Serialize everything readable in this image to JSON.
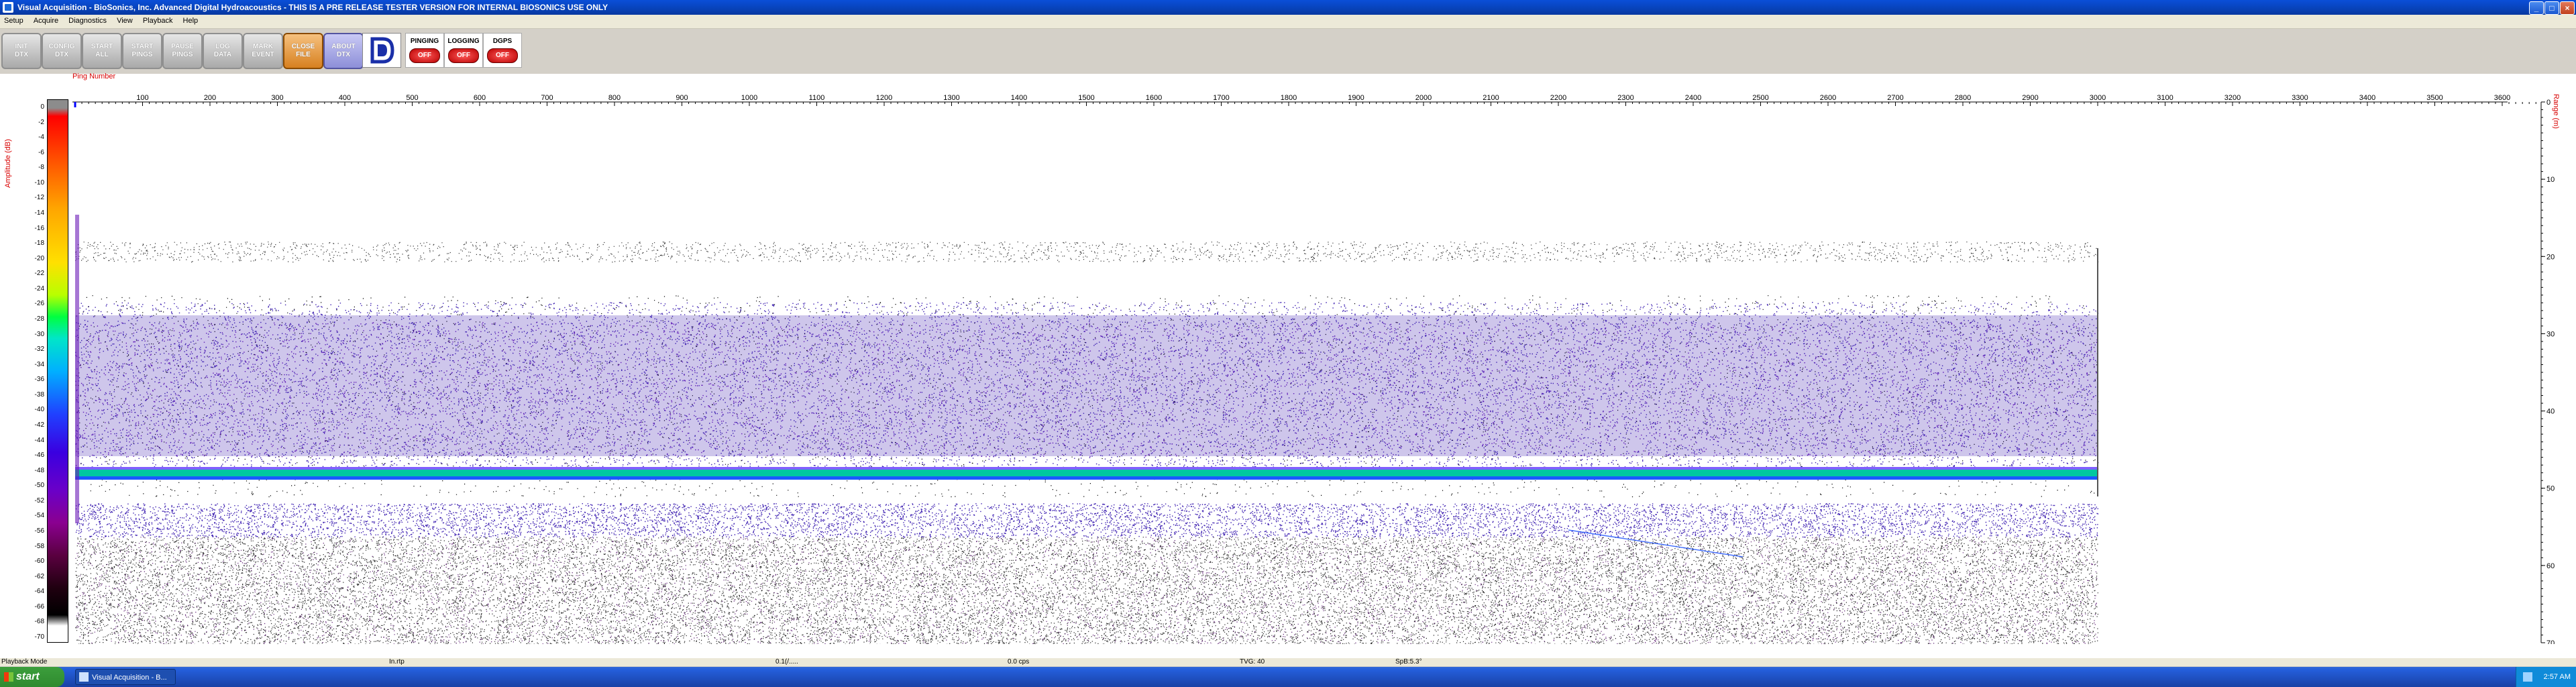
{
  "window": {
    "title": "Visual Acquisition  -  BioSonics, Inc.    Advanced Digital Hydroacoustics   -  THIS IS A PRE RELEASE TESTER VERSION FOR INTERNAL BIOSONICS USE ONLY",
    "min": "_",
    "max": "□",
    "close": "×"
  },
  "menu": [
    "Setup",
    "Acquire",
    "Diagnostics",
    "View",
    "Playback",
    "Help"
  ],
  "toolbar": {
    "buttons": [
      {
        "label": "INIT\nDTX",
        "style": "gray"
      },
      {
        "label": "CONFIG\nDTX",
        "style": "gray"
      },
      {
        "label": "START\nALL",
        "style": "gray"
      },
      {
        "label": "START\nPINGS",
        "style": "gray"
      },
      {
        "label": "PAUSE\nPINGS",
        "style": "gray"
      },
      {
        "label": "LOG\nDATA",
        "style": "gray"
      },
      {
        "label": "MARK\nEVENT",
        "style": "gray"
      },
      {
        "label": "CLOSE\nFILE",
        "style": "orange"
      },
      {
        "label": "ABOUT\nDTX",
        "style": "blue"
      }
    ],
    "indicators": [
      {
        "label": "PINGING",
        "state": "OFF"
      },
      {
        "label": "LOGGING",
        "state": "OFF"
      },
      {
        "label": "DGPS",
        "state": "OFF"
      }
    ]
  },
  "echogram": {
    "amplitude_axis_label": "Amplitude (dB)",
    "amplitude_ticks": [
      "0",
      "-2",
      "-4",
      "-6",
      "-8",
      "-10",
      "-12",
      "-14",
      "-16",
      "-18",
      "-20",
      "-22",
      "-24",
      "-26",
      "-28",
      "-30",
      "-32",
      "-34",
      "-36",
      "-38",
      "-40",
      "-42",
      "-44",
      "-46",
      "-48",
      "-50",
      "-52",
      "-54",
      "-56",
      "-58",
      "-60",
      "-62",
      "-64",
      "-66",
      "-68",
      "-70"
    ],
    "ping_axis_label": "Ping Number",
    "ping_ticks": [
      "100",
      "200",
      "300",
      "400",
      "500",
      "600",
      "700",
      "800",
      "900",
      "1000",
      "1100",
      "1200",
      "1300",
      "1400",
      "1500",
      "1600",
      "1700",
      "1800",
      "1900",
      "2000",
      "2100",
      "2200",
      "2300",
      "2400",
      "2500",
      "2600",
      "2700",
      "2800",
      "2900",
      "3000",
      "3100",
      "3200",
      "3300",
      "3400",
      "3500",
      "3600"
    ],
    "range_axis_label": "Range (m)",
    "range_ticks": [
      "0",
      "10",
      "20",
      "30",
      "40",
      "50",
      "60",
      "70.0"
    ],
    "ping_max": 3000,
    "colors": {
      "bottom": "#00c8a0",
      "band": "#3a1cb0",
      "noise": "#000000"
    }
  },
  "statusbar": [
    {
      "text": "Playback Mode"
    },
    {
      "text": "In.rtp"
    },
    {
      "text": "0.1(/....."
    },
    {
      "text": "0.0 cps"
    },
    {
      "text": "TVG: 40"
    },
    {
      "text": "SpB:5.3°"
    }
  ],
  "taskbar": {
    "start": "start",
    "task": "Visual Acquisition - B...",
    "clock": "2:57 AM"
  }
}
